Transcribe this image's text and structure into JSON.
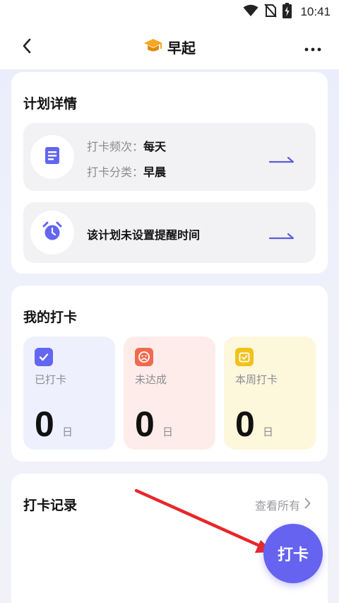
{
  "status_bar": {
    "time": "10:41",
    "icons": [
      "wifi-icon",
      "no-sim-icon",
      "battery-charging-icon"
    ]
  },
  "header": {
    "title": "早起",
    "title_icon": "graduation-cap-icon",
    "back_icon": "back-chevron-icon",
    "more_icon": "more-dots-icon"
  },
  "plan": {
    "title": "计划详情",
    "frequency_label": "打卡频次：",
    "frequency_value": "每天",
    "category_label": "打卡分类：",
    "category_value": "早晨",
    "reminder_text": "该计划未设置提醒时间"
  },
  "my_checkin": {
    "title": "我的打卡",
    "stats": [
      {
        "label": "已打卡",
        "value": "0",
        "unit": "日",
        "color": "#eef1fd",
        "icon": "check-badge-icon",
        "icon_color": "#6366f1"
      },
      {
        "label": "未达成",
        "value": "0",
        "unit": "日",
        "color": "#fdecea",
        "icon": "sad-face-icon",
        "icon_color": "#f06a4f"
      },
      {
        "label": "本周打卡",
        "value": "0",
        "unit": "日",
        "color": "#fdf7dc",
        "icon": "calendar-check-icon",
        "icon_color": "#f2c21b"
      }
    ]
  },
  "records": {
    "title": "打卡记录",
    "view_all": "查看所有"
  },
  "checkin_button": {
    "label": "打卡"
  },
  "colors": {
    "accent": "#6663f0",
    "annotation_arrow": "#e8262a"
  }
}
